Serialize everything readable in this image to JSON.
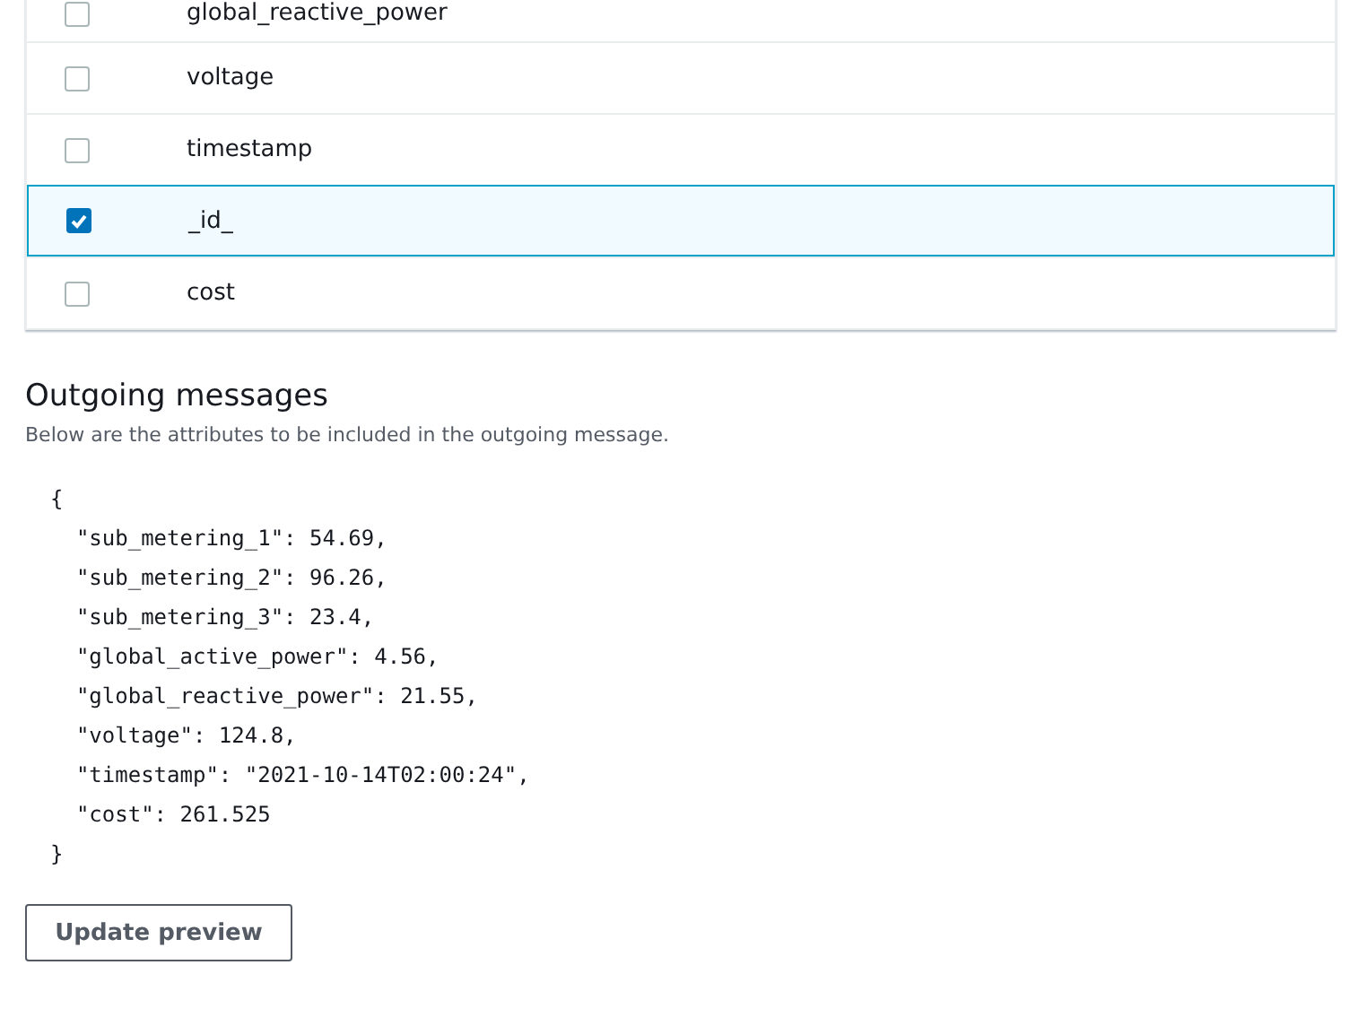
{
  "attributes": [
    {
      "name": "global_reactive_power",
      "checked": false
    },
    {
      "name": "voltage",
      "checked": false
    },
    {
      "name": "timestamp",
      "checked": false
    },
    {
      "name": "_id_",
      "checked": true
    },
    {
      "name": "cost",
      "checked": false
    }
  ],
  "outgoing": {
    "title": "Outgoing messages",
    "description": "Below are the attributes to be included in the outgoing message.",
    "preview_lines": [
      "{",
      "  \"sub_metering_1\": 54.69,",
      "  \"sub_metering_2\": 96.26,",
      "  \"sub_metering_3\": 23.4,",
      "  \"global_active_power\": 4.56,",
      "  \"global_reactive_power\": 21.55,",
      "  \"voltage\": 124.8,",
      "  \"timestamp\": \"2021-10-14T02:00:24\",",
      "  \"cost\": 261.525",
      "}"
    ]
  },
  "buttons": [
    "Update preview"
  ]
}
